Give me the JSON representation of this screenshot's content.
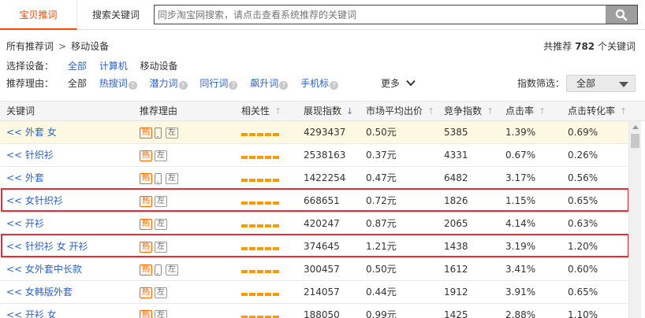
{
  "tabs": {
    "active": "宝贝推词",
    "second": "搜索关键词"
  },
  "search": {
    "placeholder": "同步淘宝网搜索，请点击查看系统推荐的关键词"
  },
  "breadcrumb": {
    "root": "所有推荐词",
    "separator": ">",
    "current": "移动设备"
  },
  "total": {
    "prefix": "共推荐",
    "count": "782",
    "suffix": "个关键词"
  },
  "device": {
    "label": "选择设备：",
    "options": [
      "全部",
      "计算机",
      "移动设备"
    ]
  },
  "reason": {
    "label": "推荐理由：",
    "all": "全部",
    "options": [
      "热搜词",
      "潜力词",
      "同行词",
      "飙升词",
      "手机标"
    ],
    "help_glyph": "?",
    "more": "更多"
  },
  "index_filter": {
    "label": "指数筛选：",
    "value": "全部"
  },
  "badges": {
    "hot": "热",
    "left": "左"
  },
  "table": {
    "headers": [
      "关键词",
      "推荐理由",
      "相关性",
      "展现指数",
      "市场平均出价",
      "竞争指数",
      "点击率",
      "点击转化率"
    ],
    "sort_arrow": "↑",
    "sort_active": "↓",
    "rows": [
      {
        "keyword": "<< 外套 女",
        "phone": true,
        "impressions": "4293437",
        "price": "0.50元",
        "competition": "5385",
        "ctr": "1.39%",
        "cvr": "0.69%",
        "highlight": true
      },
      {
        "keyword": "<< 针织衫",
        "phone": false,
        "impressions": "2538163",
        "price": "0.37元",
        "competition": "4331",
        "ctr": "0.67%",
        "cvr": "0.26%"
      },
      {
        "keyword": "<< 外套",
        "phone": true,
        "impressions": "1422254",
        "price": "0.47元",
        "competition": "6482",
        "ctr": "3.17%",
        "cvr": "0.56%"
      },
      {
        "keyword": "<< 女针织衫",
        "phone": false,
        "impressions": "668651",
        "price": "0.72元",
        "competition": "1826",
        "ctr": "1.15%",
        "cvr": "0.65%",
        "boxed": true
      },
      {
        "keyword": "<< 开衫",
        "phone": false,
        "impressions": "420247",
        "price": "0.87元",
        "competition": "2065",
        "ctr": "4.14%",
        "cvr": "0.63%"
      },
      {
        "keyword": "<< 针织衫 女 开衫",
        "phone": false,
        "impressions": "374645",
        "price": "1.21元",
        "competition": "1438",
        "ctr": "3.19%",
        "cvr": "1.20%",
        "boxed": true
      },
      {
        "keyword": "<< 女外套中长款",
        "phone": true,
        "impressions": "300457",
        "price": "0.50元",
        "competition": "1612",
        "ctr": "3.41%",
        "cvr": "0.60%"
      },
      {
        "keyword": "<< 女韩版外套",
        "phone": false,
        "impressions": "214057",
        "price": "0.44元",
        "competition": "1912",
        "ctr": "3.91%",
        "cvr": "0.65%"
      },
      {
        "keyword": "<< 开衫 女",
        "phone": false,
        "impressions": "188050",
        "price": "0.99元",
        "competition": "1425",
        "ctr": "2.88%",
        "cvr": "1.10%"
      }
    ]
  },
  "colors": {
    "accent": "#ff4400",
    "link": "#2a62c9",
    "highlight_row": "#fdf8e1",
    "relevance_bar": "#ff9900",
    "annotation_box": "#e1303b"
  }
}
